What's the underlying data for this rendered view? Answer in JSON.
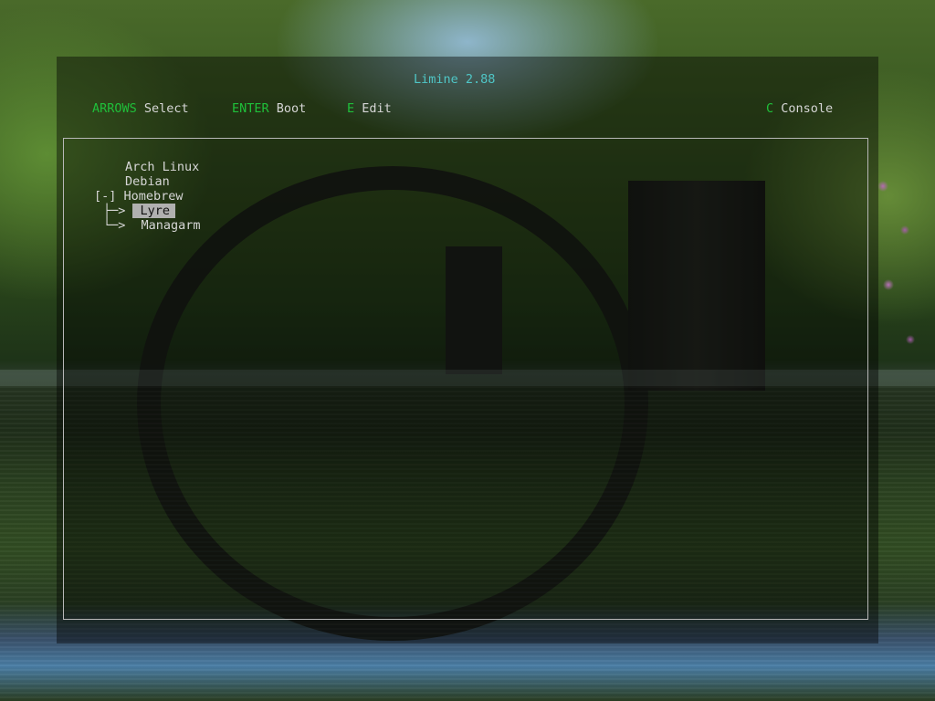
{
  "title": "Limine 2.88",
  "hints": {
    "arrows_key": "ARROWS",
    "arrows_action": "Select",
    "enter_key": "ENTER",
    "enter_action": "Boot",
    "edit_key": "E",
    "edit_action": "Edit",
    "console_key": "C",
    "console_action": "Console"
  },
  "menu": {
    "entries": [
      {
        "prefix": "",
        "label": "Arch Linux"
      },
      {
        "prefix": "",
        "label": "Debian"
      },
      {
        "prefix": "[-]",
        "label": "Homebrew"
      }
    ],
    "sub_entries": [
      {
        "prefix": "├─>",
        "label": "Lyre",
        "selected": true
      },
      {
        "prefix": "└─>",
        "label": "Managarm",
        "selected": false
      }
    ]
  },
  "colors": {
    "title": "#4fc6c6",
    "key": "#1fbf3a",
    "text": "#d6d6d6",
    "selection_bg": "#b0b0b0"
  }
}
